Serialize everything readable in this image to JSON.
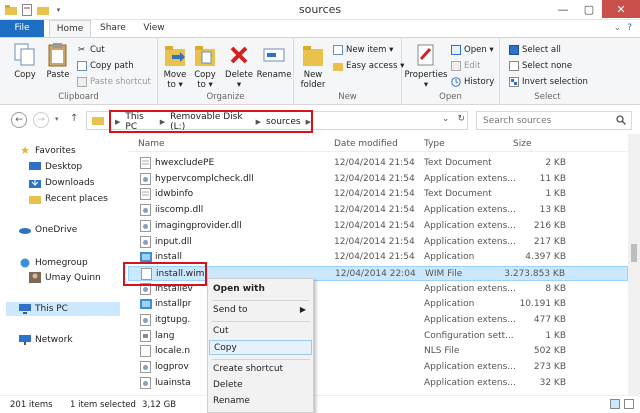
{
  "window": {
    "title": "sources",
    "minimize": "—",
    "maximize": "▢",
    "close": "✕"
  },
  "tabs": {
    "file": "File",
    "home": "Home",
    "share": "Share",
    "view": "View"
  },
  "ribbon": {
    "clipboard": {
      "copy": "Copy",
      "paste": "Paste",
      "cut": "Cut",
      "copy_path": "Copy path",
      "paste_shortcut": "Paste shortcut",
      "label": "Clipboard"
    },
    "organize": {
      "move_to": "Move\nto ▾",
      "copy_to": "Copy\nto ▾",
      "delete": "Delete\n▾",
      "rename": "Rename",
      "label": "Organize"
    },
    "new": {
      "new_folder": "New\nfolder",
      "new_item": "New item ▾",
      "easy_access": "Easy access ▾",
      "label": "New"
    },
    "open": {
      "properties": "Properties\n▾",
      "open": "Open ▾",
      "edit": "Edit",
      "history": "History",
      "label": "Open"
    },
    "select": {
      "select_all": "Select all",
      "select_none": "Select none",
      "invert": "Invert selection",
      "label": "Select"
    }
  },
  "address": {
    "crumbs": [
      "This PC",
      "Removable Disk (L:)",
      "sources"
    ],
    "search_placeholder": "Search sources"
  },
  "navpane": {
    "favorites": "Favorites",
    "desktop": "Desktop",
    "downloads": "Downloads",
    "recent": "Recent places",
    "onedrive": "OneDrive",
    "homegroup": "Homegroup",
    "user": "Umay Quinn",
    "thispc": "This PC",
    "network": "Network"
  },
  "columns": {
    "name": "Name",
    "date": "Date modified",
    "type": "Type",
    "size": "Size"
  },
  "files": [
    {
      "name": "hwexcludePE",
      "date": "12/04/2014 21:54",
      "type": "Text Document",
      "size": "2 KB"
    },
    {
      "name": "hypervcomplcheck.dll",
      "date": "12/04/2014 21:54",
      "type": "Application extens...",
      "size": "11 KB"
    },
    {
      "name": "idwbinfo",
      "date": "12/04/2014 21:54",
      "type": "Text Document",
      "size": "1 KB"
    },
    {
      "name": "iiscomp.dll",
      "date": "12/04/2014 21:54",
      "type": "Application extens...",
      "size": "13 KB"
    },
    {
      "name": "imagingprovider.dll",
      "date": "12/04/2014 21:54",
      "type": "Application extens...",
      "size": "216 KB"
    },
    {
      "name": "input.dll",
      "date": "12/04/2014 21:54",
      "type": "Application extens...",
      "size": "217 KB"
    },
    {
      "name": "install",
      "date": "12/04/2014 21:54",
      "type": "Application",
      "size": "4.397 KB"
    },
    {
      "name": "install.wim",
      "date": "12/04/2014 22:04",
      "type": "WIM File",
      "size": "3.273.853 KB"
    },
    {
      "name": "installev",
      "date": "",
      "type": "Application extens...",
      "size": "8 KB"
    },
    {
      "name": "installpr",
      "date": "",
      "type": "Application",
      "size": "10.191 KB"
    },
    {
      "name": "itgtupg.",
      "date": "",
      "type": "Application extens...",
      "size": "477 KB"
    },
    {
      "name": "lang",
      "date": "",
      "type": "Configuration sett...",
      "size": "1 KB"
    },
    {
      "name": "locale.n",
      "date": "",
      "type": "NLS File",
      "size": "502 KB"
    },
    {
      "name": "logprov",
      "date": "",
      "type": "Application extens...",
      "size": "273 KB"
    },
    {
      "name": "luainsta",
      "date": "",
      "type": "Application extens...",
      "size": "32 KB"
    }
  ],
  "context_menu": {
    "open_with": "Open with",
    "send_to": "Send to",
    "cut": "Cut",
    "copy": "Copy",
    "create_shortcut": "Create shortcut",
    "delete": "Delete",
    "rename": "Rename"
  },
  "status": {
    "count": "201 items",
    "selected": "1 item selected",
    "size": "3,12 GB"
  }
}
